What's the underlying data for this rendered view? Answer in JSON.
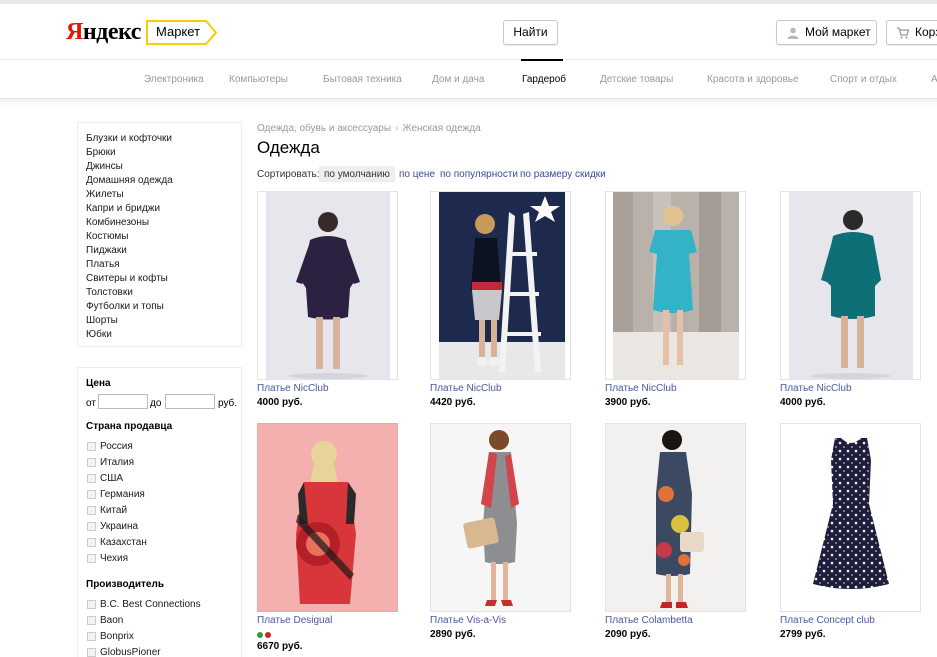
{
  "header": {
    "logo_first": "Я",
    "logo_rest": "ндекс",
    "market_label": "Маркет",
    "find_label": "Найти",
    "mymarket_label": "Мой маркет",
    "cart_label": "Корз"
  },
  "nav": {
    "items": [
      {
        "label": "Электроника"
      },
      {
        "label": "Компьютеры"
      },
      {
        "label": "Бытовая техника"
      },
      {
        "label": "Дом и дача"
      },
      {
        "label": "Гардероб",
        "active": true
      },
      {
        "label": "Детские товары"
      },
      {
        "label": "Красота и здоровье"
      },
      {
        "label": "Спорт и отдых"
      },
      {
        "label": "А"
      }
    ]
  },
  "sidebar": {
    "categories": [
      "Блузки и кофточки",
      "Брюки",
      "Джинсы",
      "Домашняя одежда",
      "Жилеты",
      "Капри и бриджи",
      "Комбинезоны",
      "Костюмы",
      "Пиджаки",
      "Платья",
      "Свитеры и кофты",
      "Толстовки",
      "Футболки и топы",
      "Шорты",
      "Юбки"
    ],
    "price": {
      "title": "Цена",
      "from": "от",
      "to": "до",
      "currency": "руб."
    },
    "country": {
      "title": "Страна продавца",
      "options": [
        "Россия",
        "Италия",
        "США",
        "Германия",
        "Китай",
        "Украина",
        "Казахстан",
        "Чехия"
      ]
    },
    "maker": {
      "title": "Производитель",
      "options": [
        "B.C. Best Connections",
        "Baon",
        "Bonprix",
        "GlobusPioner"
      ]
    }
  },
  "main": {
    "breadcrumb": [
      "Одежда, обувь и аксессуары",
      "Женская одежда"
    ],
    "title": "Одежда",
    "sort": {
      "label": "Сортировать:",
      "options": [
        {
          "label": "по умолчанию",
          "active": true
        },
        {
          "label": "по цене"
        },
        {
          "label": "по популярности"
        },
        {
          "label": "по размеру скидки"
        }
      ]
    },
    "products": [
      {
        "name": "Платье NicClub",
        "price": "4000 руб."
      },
      {
        "name": "Платье NicClub",
        "price": "4420 руб."
      },
      {
        "name": "Платье NicClub",
        "price": "3900 руб."
      },
      {
        "name": "Платье NicClub",
        "price": "4000 руб."
      },
      {
        "name": "Платье Desigual",
        "price": "6670 руб.",
        "color_dots": [
          "#2e9e3a",
          "#d62020"
        ]
      },
      {
        "name": "Платье Vis-a-Vis",
        "price": "2890 руб."
      },
      {
        "name": "Платье Colambetta",
        "price": "2090 руб."
      },
      {
        "name": "Платье Concept club",
        "price": "2799 руб."
      }
    ]
  },
  "colors": {
    "accent_red": "#e61400",
    "link": "#4b57a3",
    "market_tag": "#ffcc00"
  }
}
